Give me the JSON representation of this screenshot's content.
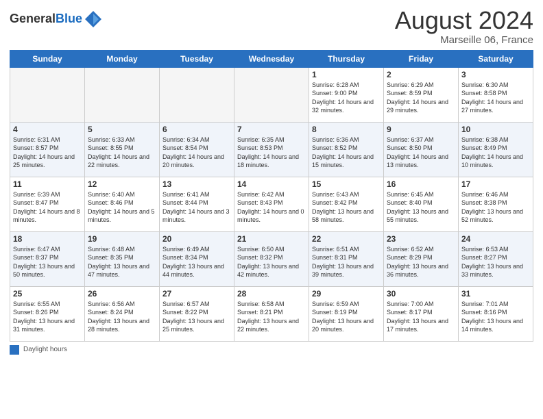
{
  "header": {
    "logo_general": "General",
    "logo_blue": "Blue",
    "month": "August 2024",
    "location": "Marseille 06, France"
  },
  "days_of_week": [
    "Sunday",
    "Monday",
    "Tuesday",
    "Wednesday",
    "Thursday",
    "Friday",
    "Saturday"
  ],
  "weeks": [
    [
      {
        "day": "",
        "info": ""
      },
      {
        "day": "",
        "info": ""
      },
      {
        "day": "",
        "info": ""
      },
      {
        "day": "",
        "info": ""
      },
      {
        "day": "1",
        "info": "Sunrise: 6:28 AM\nSunset: 9:00 PM\nDaylight: 14 hours\nand 32 minutes."
      },
      {
        "day": "2",
        "info": "Sunrise: 6:29 AM\nSunset: 8:59 PM\nDaylight: 14 hours\nand 29 minutes."
      },
      {
        "day": "3",
        "info": "Sunrise: 6:30 AM\nSunset: 8:58 PM\nDaylight: 14 hours\nand 27 minutes."
      }
    ],
    [
      {
        "day": "4",
        "info": "Sunrise: 6:31 AM\nSunset: 8:57 PM\nDaylight: 14 hours\nand 25 minutes."
      },
      {
        "day": "5",
        "info": "Sunrise: 6:33 AM\nSunset: 8:55 PM\nDaylight: 14 hours\nand 22 minutes."
      },
      {
        "day": "6",
        "info": "Sunrise: 6:34 AM\nSunset: 8:54 PM\nDaylight: 14 hours\nand 20 minutes."
      },
      {
        "day": "7",
        "info": "Sunrise: 6:35 AM\nSunset: 8:53 PM\nDaylight: 14 hours\nand 18 minutes."
      },
      {
        "day": "8",
        "info": "Sunrise: 6:36 AM\nSunset: 8:52 PM\nDaylight: 14 hours\nand 15 minutes."
      },
      {
        "day": "9",
        "info": "Sunrise: 6:37 AM\nSunset: 8:50 PM\nDaylight: 14 hours\nand 13 minutes."
      },
      {
        "day": "10",
        "info": "Sunrise: 6:38 AM\nSunset: 8:49 PM\nDaylight: 14 hours\nand 10 minutes."
      }
    ],
    [
      {
        "day": "11",
        "info": "Sunrise: 6:39 AM\nSunset: 8:47 PM\nDaylight: 14 hours\nand 8 minutes."
      },
      {
        "day": "12",
        "info": "Sunrise: 6:40 AM\nSunset: 8:46 PM\nDaylight: 14 hours\nand 5 minutes."
      },
      {
        "day": "13",
        "info": "Sunrise: 6:41 AM\nSunset: 8:44 PM\nDaylight: 14 hours\nand 3 minutes."
      },
      {
        "day": "14",
        "info": "Sunrise: 6:42 AM\nSunset: 8:43 PM\nDaylight: 14 hours\nand 0 minutes."
      },
      {
        "day": "15",
        "info": "Sunrise: 6:43 AM\nSunset: 8:42 PM\nDaylight: 13 hours\nand 58 minutes."
      },
      {
        "day": "16",
        "info": "Sunrise: 6:45 AM\nSunset: 8:40 PM\nDaylight: 13 hours\nand 55 minutes."
      },
      {
        "day": "17",
        "info": "Sunrise: 6:46 AM\nSunset: 8:38 PM\nDaylight: 13 hours\nand 52 minutes."
      }
    ],
    [
      {
        "day": "18",
        "info": "Sunrise: 6:47 AM\nSunset: 8:37 PM\nDaylight: 13 hours\nand 50 minutes."
      },
      {
        "day": "19",
        "info": "Sunrise: 6:48 AM\nSunset: 8:35 PM\nDaylight: 13 hours\nand 47 minutes."
      },
      {
        "day": "20",
        "info": "Sunrise: 6:49 AM\nSunset: 8:34 PM\nDaylight: 13 hours\nand 44 minutes."
      },
      {
        "day": "21",
        "info": "Sunrise: 6:50 AM\nSunset: 8:32 PM\nDaylight: 13 hours\nand 42 minutes."
      },
      {
        "day": "22",
        "info": "Sunrise: 6:51 AM\nSunset: 8:31 PM\nDaylight: 13 hours\nand 39 minutes."
      },
      {
        "day": "23",
        "info": "Sunrise: 6:52 AM\nSunset: 8:29 PM\nDaylight: 13 hours\nand 36 minutes."
      },
      {
        "day": "24",
        "info": "Sunrise: 6:53 AM\nSunset: 8:27 PM\nDaylight: 13 hours\nand 33 minutes."
      }
    ],
    [
      {
        "day": "25",
        "info": "Sunrise: 6:55 AM\nSunset: 8:26 PM\nDaylight: 13 hours\nand 31 minutes."
      },
      {
        "day": "26",
        "info": "Sunrise: 6:56 AM\nSunset: 8:24 PM\nDaylight: 13 hours\nand 28 minutes."
      },
      {
        "day": "27",
        "info": "Sunrise: 6:57 AM\nSunset: 8:22 PM\nDaylight: 13 hours\nand 25 minutes."
      },
      {
        "day": "28",
        "info": "Sunrise: 6:58 AM\nSunset: 8:21 PM\nDaylight: 13 hours\nand 22 minutes."
      },
      {
        "day": "29",
        "info": "Sunrise: 6:59 AM\nSunset: 8:19 PM\nDaylight: 13 hours\nand 20 minutes."
      },
      {
        "day": "30",
        "info": "Sunrise: 7:00 AM\nSunset: 8:17 PM\nDaylight: 13 hours\nand 17 minutes."
      },
      {
        "day": "31",
        "info": "Sunrise: 7:01 AM\nSunset: 8:16 PM\nDaylight: 13 hours\nand 14 minutes."
      }
    ]
  ],
  "footer": {
    "legend_label": "Daylight hours"
  }
}
